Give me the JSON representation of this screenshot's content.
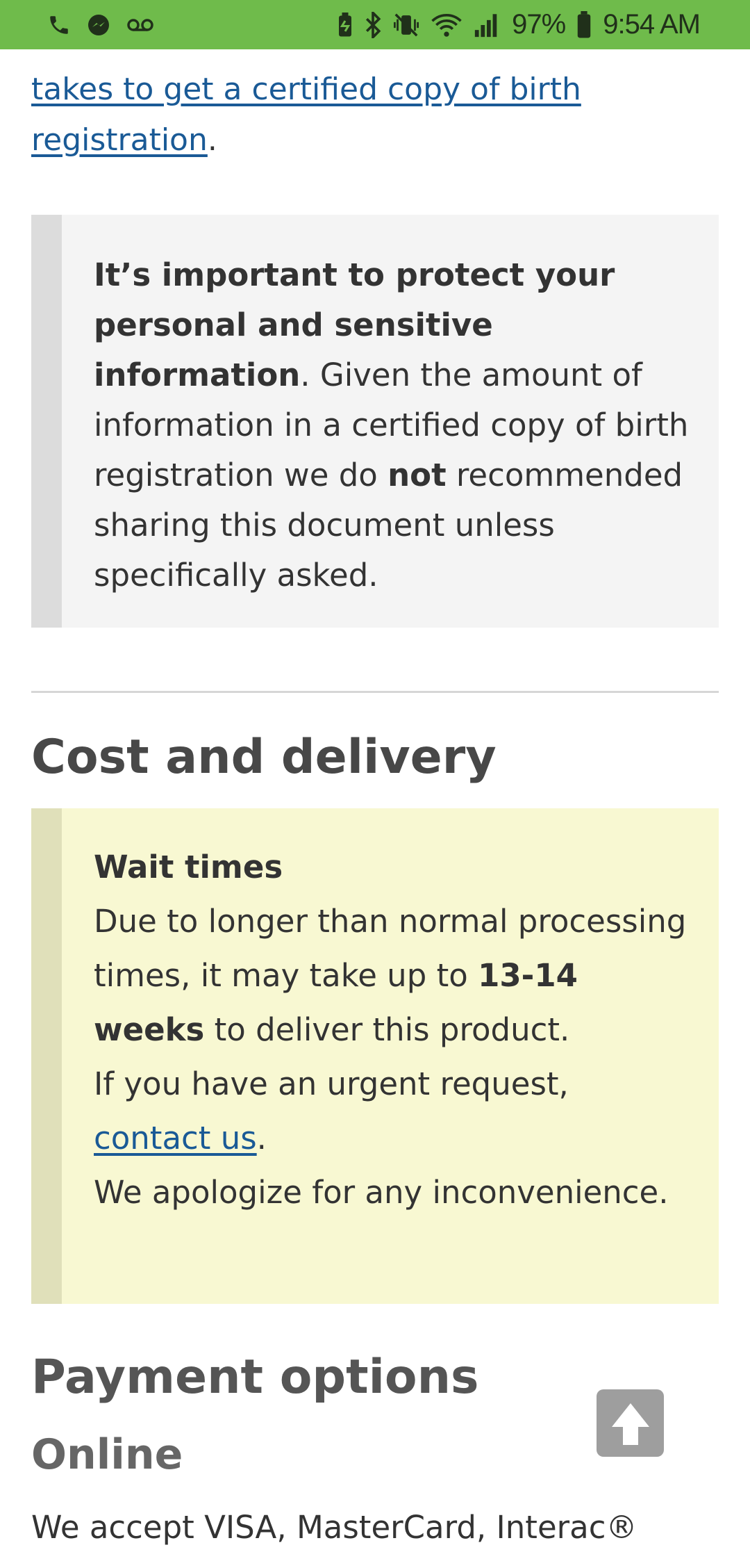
{
  "status_bar": {
    "battery": "97%",
    "time": "9:54 AM",
    "icons_left": [
      "phone-icon",
      "messenger-icon",
      "voicemail-icon"
    ],
    "icons_right": [
      "battery-saver-icon",
      "bluetooth-icon",
      "vibrate-mute-icon",
      "wifi-icon",
      "signal-icon",
      "battery-icon"
    ]
  },
  "intro": {
    "link_text": "takes to get a certified copy of birth registration",
    "suffix": "."
  },
  "privacy_note": {
    "bold_lead": "It’s important to protect your personal and sensitive information",
    "text_1": ". Given the amount of information in a certified copy of birth registration we do ",
    "bold_not": "not",
    "text_2": " recommended sharing this document unless specifically asked."
  },
  "cost_section": {
    "heading": "Cost and delivery"
  },
  "wait_times": {
    "heading": "Wait times",
    "line_1": "Due to longer than normal processing times, it may take up to ",
    "bold_weeks": "13-14 weeks",
    "line_1_end": " to deliver this product.",
    "line_2": "If you have an urgent request, ",
    "contact_link": "contact us",
    "line_2_end": ".",
    "line_3": "We apologize for any inconvenience."
  },
  "payment_section": {
    "heading": "Payment options",
    "subheading": "Online",
    "accept_text": "We accept VISA, MasterCard, Interac®"
  },
  "colors": {
    "status_bar": "#6fbb4b",
    "link": "#1a5a96",
    "grey_callout_bg": "#f4f4f4",
    "yellow_callout_bg": "#f8f8d2",
    "back_to_top_bg": "#9e9e9e"
  }
}
